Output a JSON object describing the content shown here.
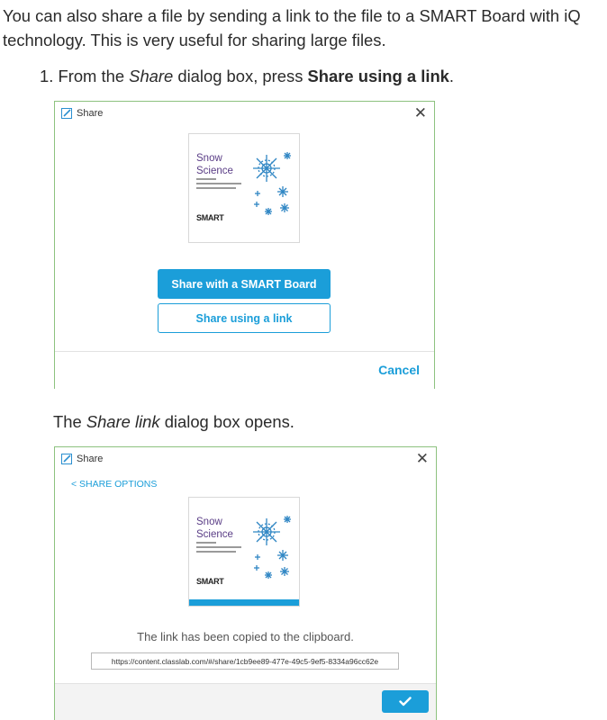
{
  "intro_text": "You can also share a file by sending a link to the file to a SMART Board with iQ technology. This is very useful for sharing large files.",
  "step1": {
    "number": "1.",
    "pre": "From the ",
    "em": "Share",
    "mid": " dialog box, press ",
    "strong": "Share using a link",
    "post": "."
  },
  "caption": {
    "pre": "The ",
    "em": "Share link",
    "post": " dialog box opens."
  },
  "dialog1": {
    "title": "Share",
    "close": "✕",
    "thumbnail": {
      "title_line1": "Snow",
      "title_line2": "Science",
      "logo": "SMART"
    },
    "share_with_board_label": "Share with a SMART Board",
    "share_link_label": "Share using a link",
    "cancel_label": "Cancel"
  },
  "dialog2": {
    "title": "Share",
    "close": "✕",
    "back_label": "< SHARE OPTIONS",
    "thumbnail": {
      "title_line1": "Snow",
      "title_line2": "Science",
      "logo": "SMART"
    },
    "message": "The link has been copied to the clipboard.",
    "link_value": "https://content.classlab.com/#/share/1cb9ee89-477e-49c5-9ef5-8334a96cc62e",
    "ok_icon": "checkmark-icon"
  },
  "colors": {
    "accent": "#1b9ed9",
    "dialog_border": "#8dc27f",
    "thumb_title": "#5a3d86"
  }
}
